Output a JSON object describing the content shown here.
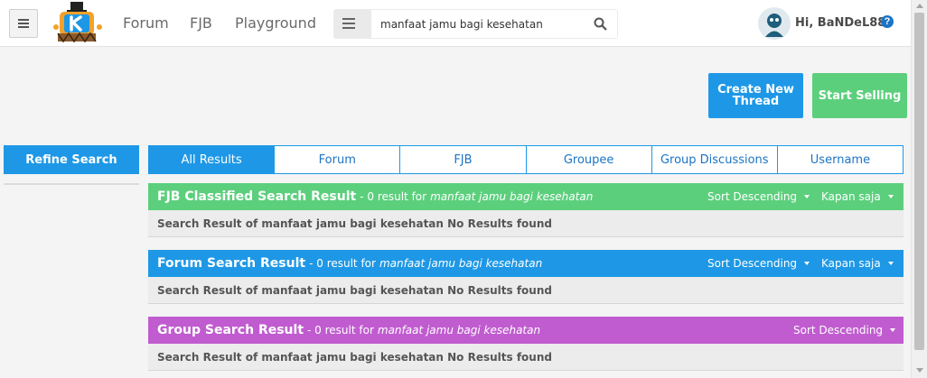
{
  "navbar": {
    "links": [
      "Forum",
      "FJB",
      "Playground"
    ],
    "search_value": "manfaat jamu bagi kesehatan",
    "greeting": "Hi, BaNDeL88",
    "help": "?"
  },
  "actions": {
    "create_thread": "Create New Thread",
    "start_selling": "Start Selling"
  },
  "sidebar": {
    "refine_label": "Refine Search"
  },
  "tabs": [
    "All Results",
    "Forum",
    "FJB",
    "Groupee",
    "Group Discussions",
    "Username"
  ],
  "results": [
    {
      "title": "FJB Classified Search Result",
      "count": "- 0 result for",
      "query": "manfaat jamu bagi kesehatan",
      "sort": "Sort Descending",
      "time": "Kapan saja",
      "body": "Search Result of manfaat jamu bagi kesehatan No Results found",
      "color": "#5ccf7d"
    },
    {
      "title": "Forum Search Result",
      "count": "- 0 result for",
      "query": "manfaat jamu bagi kesehatan",
      "sort": "Sort Descending",
      "time": "Kapan saja",
      "body": "Search Result of manfaat jamu bagi kesehatan No Results found",
      "color": "#1e98e6"
    },
    {
      "title": "Group Search Result",
      "count": "- 0 result for",
      "query": "manfaat jamu bagi kesehatan",
      "sort": "Sort Descending",
      "body": "Search Result of manfaat jamu bagi kesehatan No Results found",
      "color": "#c05ccf"
    }
  ]
}
